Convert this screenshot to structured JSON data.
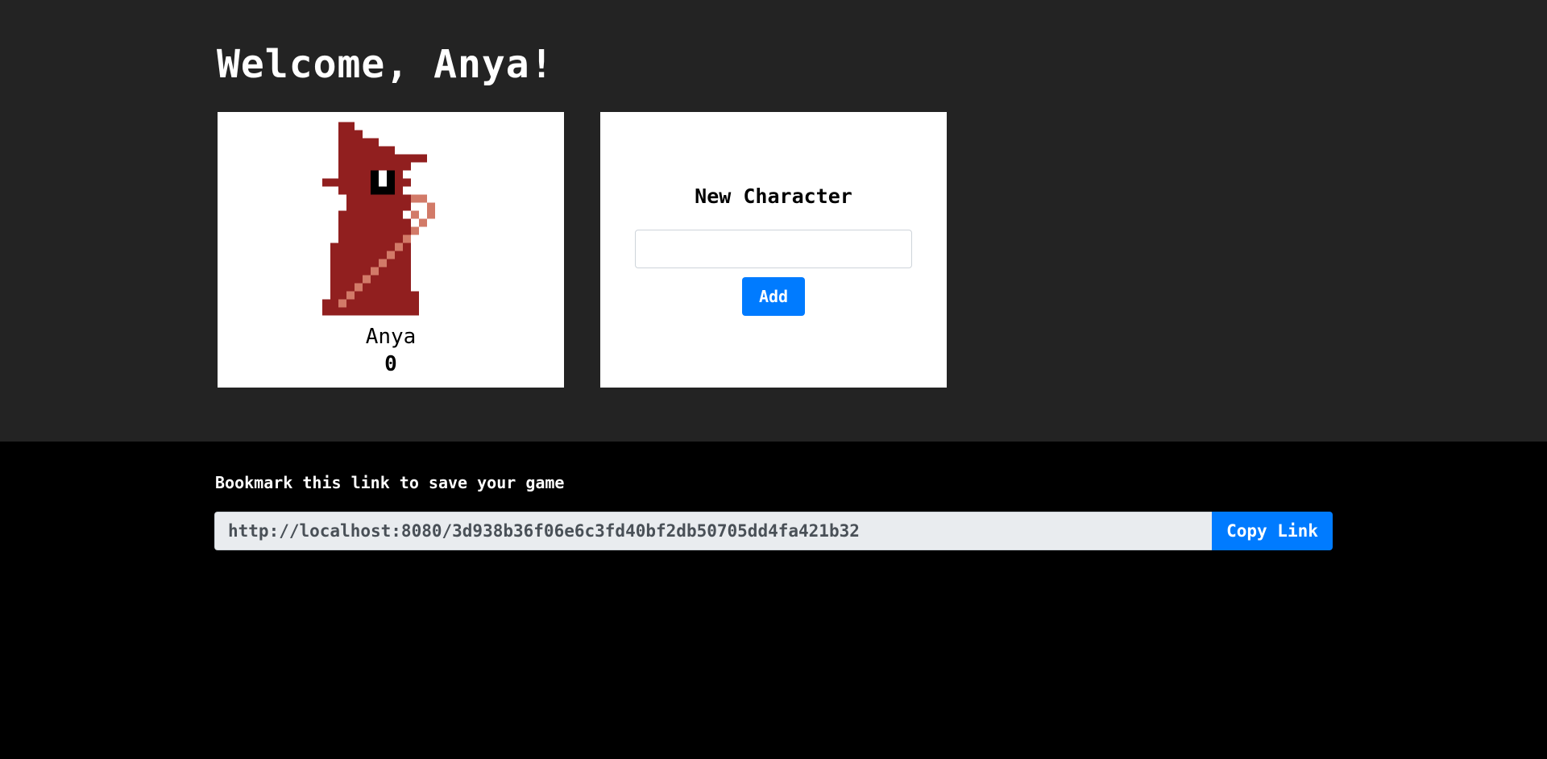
{
  "header": {
    "welcome_text": "Welcome, Anya!"
  },
  "characters": [
    {
      "name": "Anya",
      "score": "0",
      "sprite": "red-wizard-icon"
    }
  ],
  "new_character": {
    "title": "New Character",
    "input_value": "",
    "input_placeholder": "",
    "add_label": "Add"
  },
  "bookmark": {
    "label": "Bookmark this link to save your game",
    "link": "http://localhost:8080/3d938b36f06e6c3fd40bf2db50705dd4fa421b32",
    "copy_label": "Copy Link"
  },
  "colors": {
    "top_background": "#232323",
    "bottom_background": "#000000",
    "card_background": "#ffffff",
    "primary_button": "#007bff",
    "wizard_robe": "#911f1f",
    "wizard_staff": "#d27a68"
  }
}
